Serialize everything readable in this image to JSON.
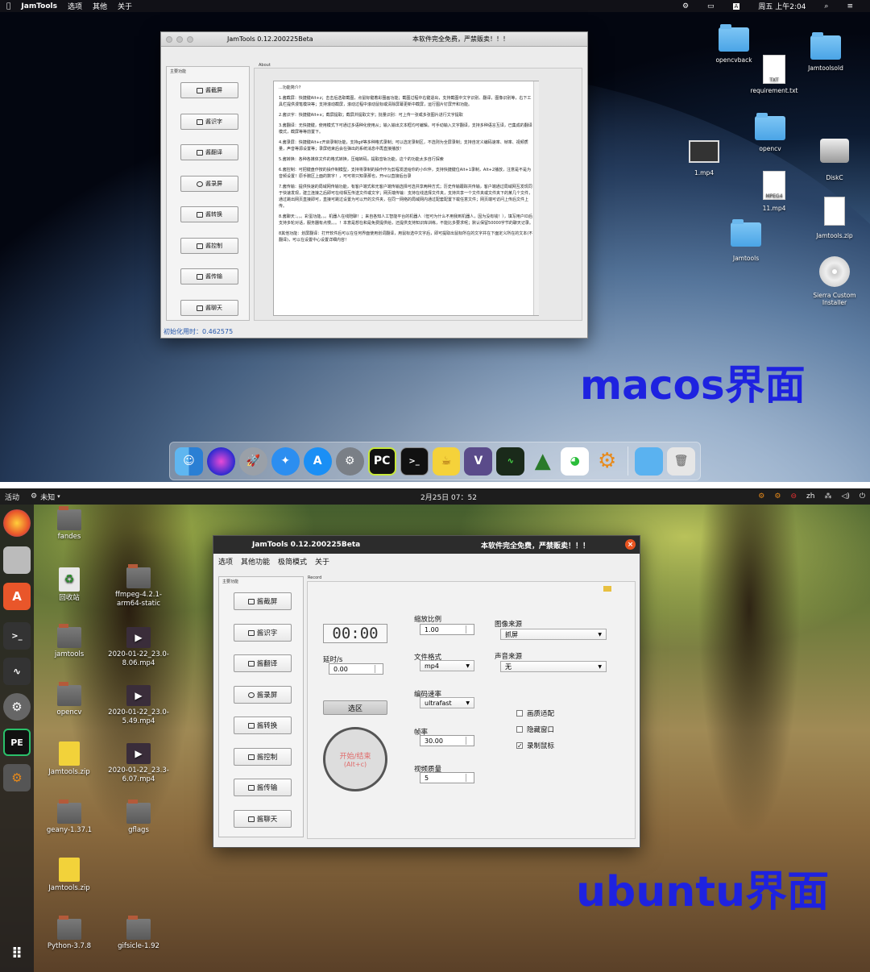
{
  "mac": {
    "menubar": {
      "app": "JamTools",
      "menus": [
        "选项",
        "其他",
        "关于"
      ],
      "clock": "周五 上午2:04",
      "input_badge": "A"
    },
    "window": {
      "title": "JamTools 0.12.200225Beta",
      "notice": "本软件完全免费，严禁贩卖！！！",
      "sidebar_header": "主要功能",
      "buttons": [
        "酱截屏",
        "酱识字",
        "酱翻译",
        "酱录屏",
        "酱转换",
        "酱控制",
        "酱传输",
        "酱聊天"
      ],
      "about_label": "About",
      "about_text": [
        "...功能简介?",
        "1.酱截屏：快捷键Alt+z；击击后选取截图，点鼠标键着彩圈画功能；截图过程中右键退出，支持截图中文字识别、翻译，图像识别等，右下工具栏提供漫笔模块等；支持滚动截屏，滚动过程中滚动鼠标或清除屏幕更新中截屏，运行图片钉屏开和功能。",
        "2.酱识字：快捷键Alt+x；截屏提取；截屏并提取文字；批量识别：可上传一张或多张图片进行文字提取",
        "3.酱翻译：无快捷键，使用模式下可通过多语种化使用从；输入输出文本框均可编辑。可手动输入文字翻译，支持多种语言互译，已集成的翻译模式，截屏等等前置下。",
        "4.酱录屏：快捷键Alt+c开启录制功能，支持gif等多种格式录制；可以选定录制区，不选则为全屏录制；支持自定义编码速率、帧率、视频质量，声音等源设置等；录屏结束后会在弹出的系统消息中再直接播放！",
        "5.酱转换：各种各媒体文件的格式转换，压缩转码，提取音轨功能，这个的功能太多自行探索",
        "6.酱控制：可把键盘作按的操作制模型，支持将录制的操作作为剪程发送给你的小伙伴，支持快捷键位Alt+1录制，Alt+2播放，注意是不是为音频设置！原手腕区上面的数字！，可可将只知录那也，开ni以直接后台录",
        "7.酱传输：提供快速的局域网传输功能，有客户端式和无客户端传输选择可选共享两种方式；历史传输跟踪共传输，客户端通过局域网互发现同于快速发现，建立连接之后即可在线相互传送文件或文字；网页端传输：支持在线选择文件夹，支持共享一个文件夹或文件夹下的某几个文件，通过跳出网页直接即可，直接可跳过设置为可以开的文件夹，在同一网络的局域网内通过配套配置下载任意文件；网页端可访问上传后文件上传。",
        "8.酱聊天：。。。彩蛋功能。。。机器人在线陪聊！；来自各知人工智能平台的机器人（但可为什么不用我到机器人，因为没有钱！），填写用户ID后支持多轮对话，服务器有点慢。。。！本意是想在和是免费提供给，还提供支持知识库训练，不能比多要求呢；默认保留50000字节的聊天记录。",
        "8其他功能：划屏翻译：打开软件后可以在任何界面使用划词翻译，用鼠标选中文字后，即可提取出鼠标所在的文字并在下面定义所在的文本(不翻译)，可以在设置中心设置详细内容！"
      ],
      "status": "初始化用时：0.462575"
    },
    "desktop_icons": [
      {
        "label": "opencvback",
        "kind": "folder"
      },
      {
        "label": "Jamtoolsold",
        "kind": "folder"
      },
      {
        "label": "requirement.txt",
        "kind": "doc",
        "badge": "TXT"
      },
      {
        "label": "opencv",
        "kind": "folder"
      },
      {
        "label": "1.mp4",
        "kind": "video"
      },
      {
        "label": "DiskC",
        "kind": "disk"
      },
      {
        "label": "11.mp4",
        "kind": "doc",
        "badge": "MPEG4"
      },
      {
        "label": "Jamtools.zip",
        "kind": "zip"
      },
      {
        "label": "Jamtools",
        "kind": "folder"
      },
      {
        "label": "Sierra Custom Installer",
        "kind": "dvd"
      }
    ],
    "big_label": "macos界面",
    "dock": [
      "finder",
      "siri",
      "launchpad",
      "safari",
      "app-store",
      "system-preferences",
      "pycharm",
      "terminal",
      "teapot",
      "vim",
      "activity-monitor",
      "triangle",
      "wechat",
      "jamtools",
      "folder",
      "trash"
    ]
  },
  "ubuntu": {
    "topbar": {
      "activities": "活动",
      "app": "未知",
      "clock": "2月25日  07：52",
      "lang": "zh"
    },
    "window": {
      "title": "JamTools 0.12.200225Beta",
      "notice": "本软件完全免费，严禁贩卖！！！",
      "menus": [
        "选项",
        "其他功能",
        "极简模式",
        "关于"
      ],
      "sidebar_header": "主要功能",
      "buttons": [
        "酱截屏",
        "酱识字",
        "酱翻译",
        "酱录屏",
        "酱转换",
        "酱控制",
        "酱传输",
        "酱聊天"
      ],
      "record_label": "Record",
      "timer": "00:00",
      "delay_label": "延时/s",
      "delay_value": "0.00",
      "select_button": "选区",
      "start_button": "开始/结束",
      "start_hint": "(Alt+c)",
      "scale_label": "缩放比例",
      "scale_value": "1.00",
      "format_label": "文件格式",
      "format_value": "mp4",
      "encode_label": "编码速率",
      "encode_value": "ultrafast",
      "fps_label": "帧率",
      "fps_value": "30.00",
      "quality_label": "视频质量",
      "quality_value": "5",
      "image_src_label": "图像来源",
      "image_src_value": "抓屏",
      "audio_src_label": "声音来源",
      "audio_src_value": "无",
      "checks": [
        {
          "label": "画质适配",
          "checked": false
        },
        {
          "label": "隐藏窗口",
          "checked": false
        },
        {
          "label": "录制鼠标",
          "checked": true
        }
      ]
    },
    "desktop_icons": [
      {
        "label": "fandes",
        "kind": "folder"
      },
      {
        "label": "回收站",
        "kind": "recycle"
      },
      {
        "label": "ffmpeg-4.2.1-arm64-static",
        "kind": "folder"
      },
      {
        "label": "jamtools",
        "kind": "folder"
      },
      {
        "label": "2020-01-22_23.0-8.06.mp4",
        "kind": "video"
      },
      {
        "label": "opencv",
        "kind": "folder"
      },
      {
        "label": "2020-01-22_23.0-5.49.mp4",
        "kind": "video"
      },
      {
        "label": "Jamtools.zip",
        "kind": "zip"
      },
      {
        "label": "2020-01-22_23.3-6.07.mp4",
        "kind": "video"
      },
      {
        "label": "geany-1.37.1",
        "kind": "folder"
      },
      {
        "label": "gflags",
        "kind": "folder"
      },
      {
        "label": "Jamtools.zip",
        "kind": "zip"
      },
      {
        "label": "Python-3.7.8",
        "kind": "folder"
      },
      {
        "label": "gifsicle-1.92",
        "kind": "folder"
      }
    ],
    "big_label": "ubuntu界面"
  }
}
